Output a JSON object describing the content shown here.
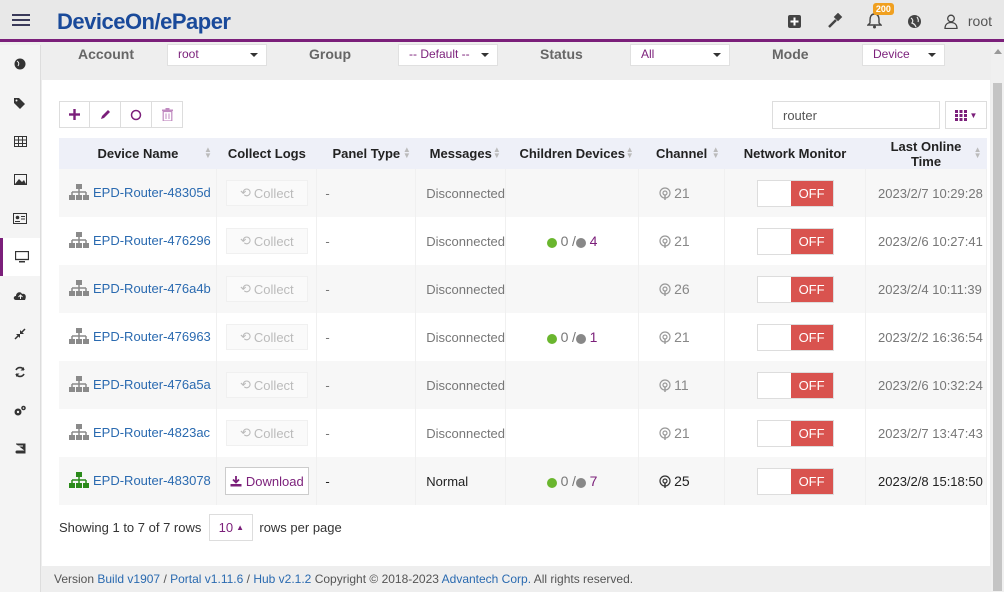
{
  "app": {
    "logo": "DeviceOn/ePaper",
    "user": "root",
    "notification_count": "200"
  },
  "filters": {
    "account_label": "Account",
    "account_value": "root",
    "group_label": "Group",
    "group_value": "-- Default --",
    "status_label": "Status",
    "status_value": "All",
    "mode_label": "Mode",
    "mode_value": "Device"
  },
  "search": {
    "value": "router"
  },
  "columns": [
    "Device Name",
    "Collect Logs",
    "Panel Type",
    "Messages",
    "Children Devices",
    "Channel",
    "Network Monitor",
    "Last Online Time"
  ],
  "rows": [
    {
      "name": "EPD-Router-48305d",
      "collect": "Collect",
      "panel": "-",
      "message": "Disconnected",
      "children_online": "",
      "children_sep": "",
      "children_offline": "",
      "channel": "21",
      "monitor": "OFF",
      "time": "2023/2/7 10:29:28"
    },
    {
      "name": "EPD-Router-476296",
      "collect": "Collect",
      "panel": "-",
      "message": "Disconnected",
      "children_online": "0",
      "children_sep": "/",
      "children_offline": "4",
      "channel": "21",
      "monitor": "OFF",
      "time": "2023/2/6 10:27:41"
    },
    {
      "name": "EPD-Router-476a4b",
      "collect": "Collect",
      "panel": "-",
      "message": "Disconnected",
      "children_online": "",
      "children_sep": "",
      "children_offline": "",
      "channel": "26",
      "monitor": "OFF",
      "time": "2023/2/4 10:11:39"
    },
    {
      "name": "EPD-Router-476963",
      "collect": "Collect",
      "panel": "-",
      "message": "Disconnected",
      "children_online": "0",
      "children_sep": "/",
      "children_offline": "1",
      "channel": "21",
      "monitor": "OFF",
      "time": "2023/2/2 16:36:54"
    },
    {
      "name": "EPD-Router-476a5a",
      "collect": "Collect",
      "panel": "-",
      "message": "Disconnected",
      "children_online": "",
      "children_sep": "",
      "children_offline": "",
      "channel": "11",
      "monitor": "OFF",
      "time": "2023/2/6 10:32:24"
    },
    {
      "name": "EPD-Router-4823ac",
      "collect": "Collect",
      "panel": "-",
      "message": "Disconnected",
      "children_online": "",
      "children_sep": "",
      "children_offline": "",
      "channel": "21",
      "monitor": "OFF",
      "time": "2023/2/7 13:47:43"
    },
    {
      "name": "EPD-Router-483078",
      "collect": "Download",
      "panel": "-",
      "message": "Normal",
      "children_online": "0",
      "children_sep": "/",
      "children_offline": "7",
      "channel": "25",
      "monitor": "OFF",
      "time": "2023/2/8 15:18:50"
    }
  ],
  "pager": {
    "showing": "Showing 1 to 7 of 7 rows",
    "page_size": "10",
    "suffix": "rows per page"
  },
  "footer": {
    "version": "Version",
    "build": "Build v1907",
    "sep1": "/",
    "portal": "Portal v1.11.6",
    "sep2": "/",
    "hub": "Hub v2.1.2",
    "copyright": "Copyright © 2018-2023",
    "company": "Advantech Corp.",
    "rights": "All rights reserved."
  },
  "colors": {
    "accent": "#7b1f7a",
    "link": "#2a6ab0",
    "off": "#d9534f",
    "online": "#6ab62e"
  }
}
